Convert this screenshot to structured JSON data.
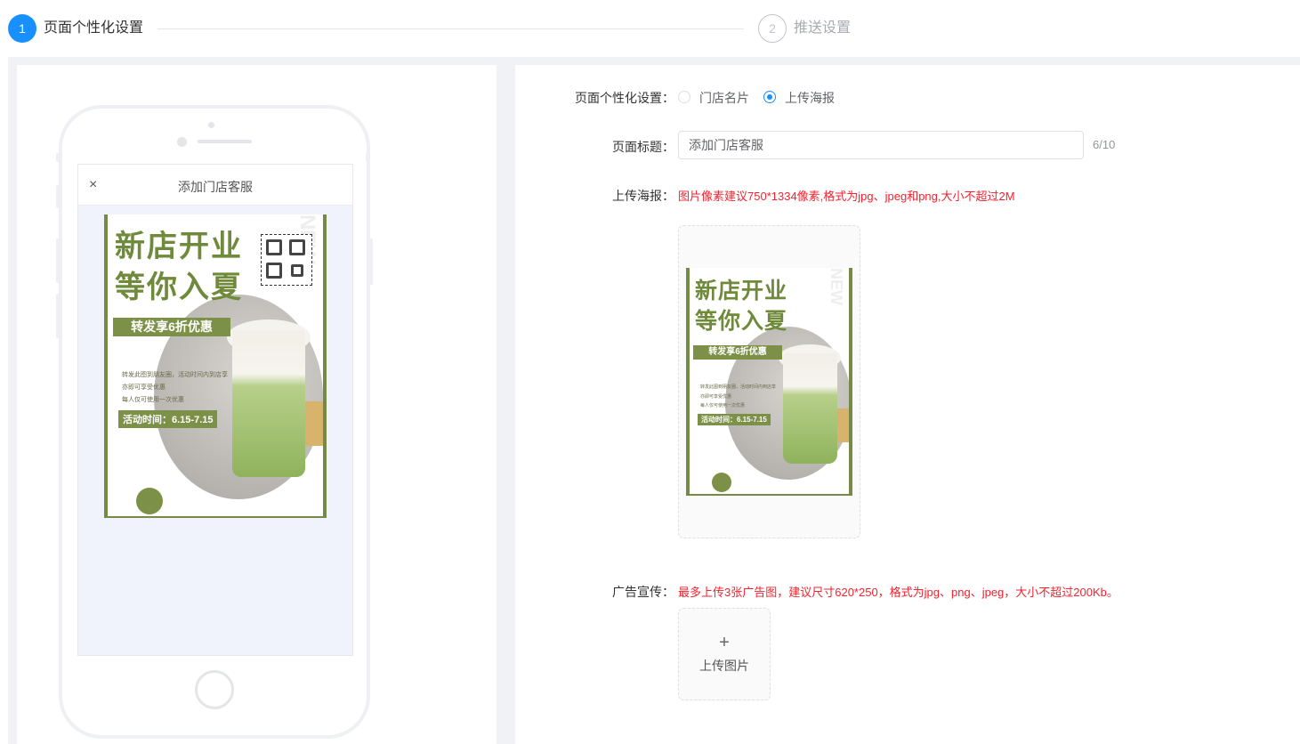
{
  "steps": [
    {
      "number": "1",
      "label": "页面个性化设置",
      "active": true
    },
    {
      "number": "2",
      "label": "推送设置",
      "active": false
    }
  ],
  "preview": {
    "close_icon": "close-icon",
    "close_glyph": "×",
    "title": "添加门店客服"
  },
  "poster": {
    "title_line1": "新店开业",
    "title_line2": "等你入夏",
    "badge": "转发享6折优惠",
    "desc_lines": [
      "转发此图到朋友圈，活动时间内到店享",
      "亦即可享受优惠",
      "每人仅可使用一次优惠"
    ],
    "time": "活动时间：6.15-7.15",
    "side_text": "NEW"
  },
  "form": {
    "mode_label": "页面个性化设置：",
    "mode_options": [
      {
        "label": "门店名片",
        "checked": false
      },
      {
        "label": "上传海报",
        "checked": true
      }
    ],
    "title_label": "页面标题：",
    "title_value": "添加门店客服",
    "title_count": "6/10",
    "poster_label": "上传海报：",
    "poster_hint": "图片像素建议750*1334像素,格式为jpg、jpeg和png,大小不超过2M",
    "ad_label": "广告宣传：",
    "ad_hint": "最多上传3张广告图，建议尺寸620*250，格式为jpg、png、jpeg，大小不超过200Kb。",
    "upload_plus": "+",
    "upload_label": "上传图片"
  },
  "colors": {
    "primary": "#1890ff",
    "error": "#f5222d",
    "poster_green": "#7c9147"
  }
}
